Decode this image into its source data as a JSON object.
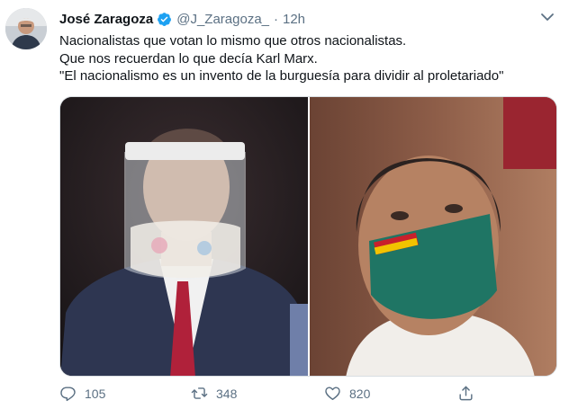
{
  "tweet": {
    "author_name": "José Zaragoza",
    "handle": "@J_Zaragoza_",
    "separator": "·",
    "time": "12h",
    "lines": [
      "Nacionalistas que votan lo mismo que otros nacionalistas.",
      "Que nos recuerdan lo que decía Karl Marx.",
      "\"El nacionalismo es un invento de la burguesía para dividir al proletariado\""
    ]
  },
  "actions": {
    "reply_count": "105",
    "retweet_count": "348",
    "like_count": "820"
  },
  "icons": {
    "verified": "verified-badge-icon",
    "more": "chevron-down-icon",
    "reply": "reply-icon",
    "retweet": "retweet-icon",
    "like": "heart-icon",
    "share": "share-icon"
  },
  "colors": {
    "verified_blue": "#1da1f2",
    "muted_text": "#5b7083",
    "text": "#0f1419"
  }
}
